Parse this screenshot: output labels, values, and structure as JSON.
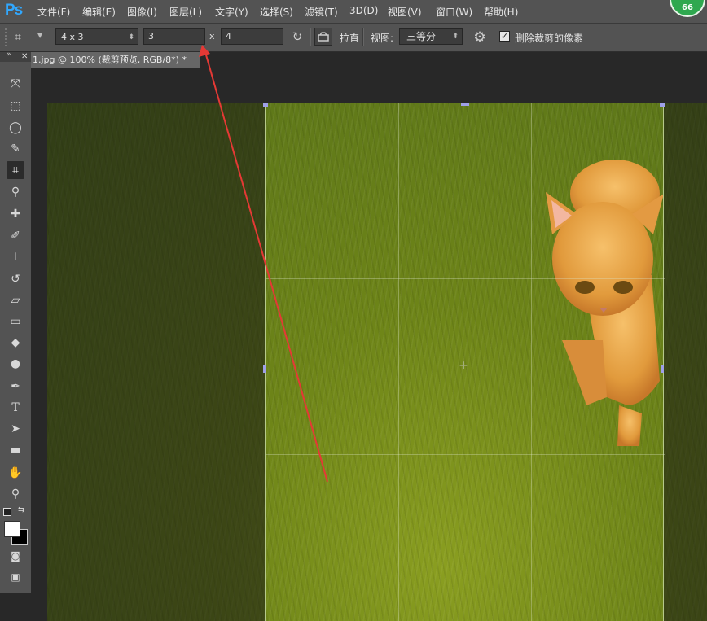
{
  "app": {
    "logo": "Ps",
    "notification_count": "66"
  },
  "menu": [
    "文件(F)",
    "编辑(E)",
    "图像(I)",
    "图层(L)",
    "文字(Y)",
    "选择(S)",
    "滤镜(T)",
    "3D(D)",
    "视图(V)",
    "窗口(W)",
    "帮助(H)"
  ],
  "options": {
    "ratio_preset": "4 x 3",
    "width_value": "3",
    "separator": "x",
    "height_value": "4",
    "straighten_label": "拉直",
    "view_label": "视图:",
    "view_value": "三等分",
    "delete_pixels_label": "删除裁剪的像素",
    "delete_pixels_checked": true
  },
  "document": {
    "tab_title": "1.jpg @ 100% (裁剪预览, RGB/8*) *"
  },
  "colors": {
    "accent": "#31a8ff",
    "annotation_arrow": "#e53935",
    "badge": "#2fa84f"
  },
  "tools": [
    "move-icon",
    "marquee-icon",
    "lasso-icon",
    "quick-select-icon",
    "crop-icon",
    "eyedropper-icon",
    "healing-icon",
    "brush-icon",
    "stamp-icon",
    "history-brush-icon",
    "eraser-icon",
    "gradient-icon",
    "blur-icon",
    "dodge-icon",
    "pen-icon",
    "type-icon",
    "path-select-icon",
    "shape-icon",
    "hand-icon",
    "zoom-icon"
  ]
}
